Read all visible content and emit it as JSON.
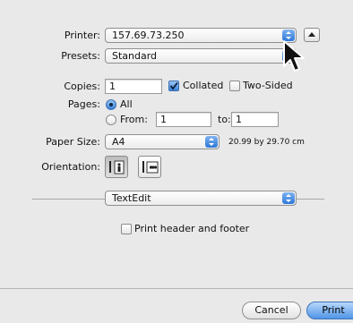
{
  "printer": {
    "label": "Printer:",
    "value": "157.69.73.250"
  },
  "presets": {
    "label": "Presets:",
    "value": "Standard"
  },
  "copies": {
    "label": "Copies:",
    "value": "1",
    "collated_label": "Collated",
    "collated_checked": true,
    "two_sided_label": "Two-Sided",
    "two_sided_checked": false
  },
  "pages": {
    "label": "Pages:",
    "all_label": "All",
    "from_label": "From:",
    "from_value": "1",
    "to_label": "to:",
    "to_value": "1",
    "selected": "All"
  },
  "paper_size": {
    "label": "Paper Size:",
    "value": "A4",
    "dimensions": "20.99 by 29.70 cm"
  },
  "orientation": {
    "label": "Orientation:",
    "selected": "portrait"
  },
  "section": {
    "value": "TextEdit"
  },
  "print_header_footer": {
    "label": "Print header and footer",
    "checked": false
  },
  "buttons": {
    "cancel": "Cancel",
    "print": "Print"
  },
  "colors": {
    "accent": "#3b82dc",
    "background": "#e9e9e9"
  }
}
